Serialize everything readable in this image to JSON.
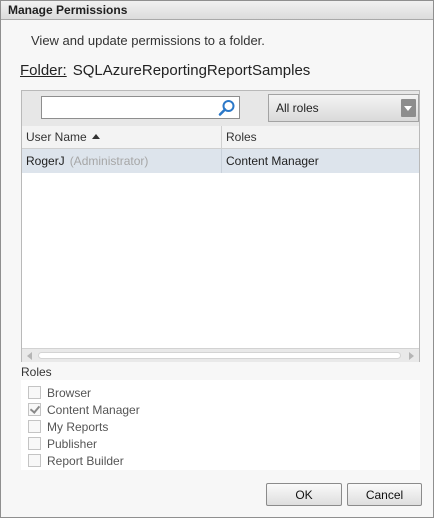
{
  "dialog": {
    "title": "Manage Permissions",
    "intro": "View and update permissions to a folder.",
    "folder_label": "Folder:",
    "folder_name": "SQLAzureReportingReportSamples"
  },
  "toolbar": {
    "search_value": "",
    "search_placeholder": "",
    "search_icon": "magnifier-icon",
    "role_filter": "All roles"
  },
  "table": {
    "columns": [
      "User Name",
      "Roles"
    ],
    "sorted_column": "User Name",
    "rows": [
      {
        "user": "RogerJ",
        "note": "(Administrator)",
        "roles": "Content Manager"
      }
    ]
  },
  "roles_section": {
    "label": "Roles",
    "items": [
      {
        "name": "Browser",
        "checked": false
      },
      {
        "name": "Content Manager",
        "checked": true
      },
      {
        "name": "My Reports",
        "checked": false
      },
      {
        "name": "Publisher",
        "checked": false
      },
      {
        "name": "Report Builder",
        "checked": false
      }
    ]
  },
  "buttons": {
    "ok": "OK",
    "cancel": "Cancel"
  },
  "colors": {
    "selected_row": "#dde4ec",
    "search_icon": "#2b78c8",
    "dialog_bg": "#f7f7f7"
  }
}
